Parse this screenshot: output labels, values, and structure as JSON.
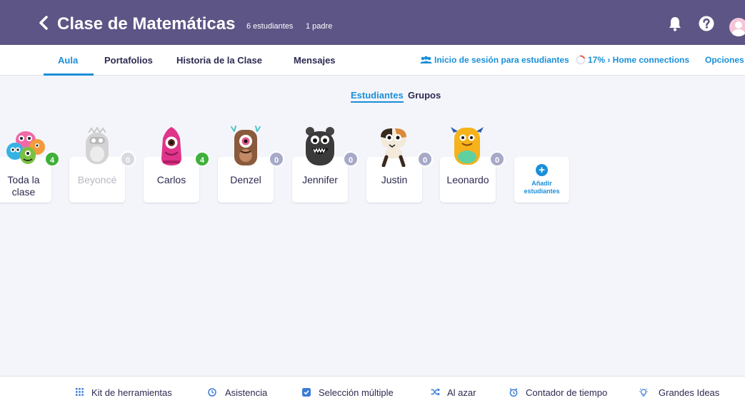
{
  "header": {
    "title": "Clase de Matemáticas",
    "students": "6 estudiantes",
    "parents": "1 padre",
    "icons": [
      "chevron-left-icon",
      "bell-icon",
      "help-icon",
      "avatar"
    ]
  },
  "tabs": [
    "Aula",
    "Portafolios",
    "Historia de la Clase",
    "Mensajes"
  ],
  "right_links": {
    "student_login": "Inicio de sesión para estudiantes",
    "home_connections": "17% › Home connections",
    "options": "Opciones"
  },
  "home_connections_progress": 0.17,
  "segment": {
    "students": "Estudiantes",
    "groups": "Grupos"
  },
  "students": [
    {
      "name": "Toda la clase",
      "line1": "Toda la",
      "line2": "clase",
      "points": "4"
    },
    {
      "name": "Beyoncé",
      "points": "0"
    },
    {
      "name": "Carlos",
      "points": "4"
    },
    {
      "name": "Denzel",
      "points": "0"
    },
    {
      "name": "Jennifer",
      "points": "0"
    },
    {
      "name": "Justin",
      "points": "0"
    },
    {
      "name": "Leonardo",
      "points": "0"
    }
  ],
  "add_students": {
    "line1": "Añadir",
    "line2": "estudiantes"
  },
  "toolbar": [
    "Kit de herramientas",
    "Asistencia",
    "Selección múltiple",
    "Al azar",
    "Contador de tiempo",
    "Grandes Ideas"
  ],
  "colors": {
    "header": "#5c5585",
    "accent": "#1a8fd8",
    "badge_green": "#3fb03a",
    "badge_grey": "#a7a9c8"
  }
}
